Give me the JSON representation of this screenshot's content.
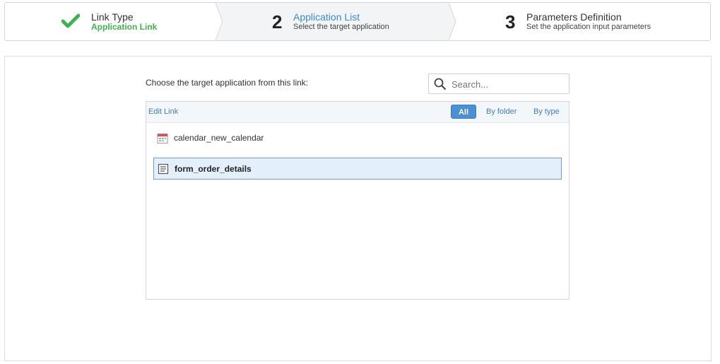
{
  "stepper": {
    "steps": [
      {
        "title": "Link Type",
        "subtitle": "Application Link",
        "status": "completed"
      },
      {
        "number": "2",
        "title": "Application List",
        "subtitle": "Select the target application",
        "status": "active"
      },
      {
        "number": "3",
        "title": "Parameters Definition",
        "subtitle": "Set the application input parameters",
        "status": "pending"
      }
    ]
  },
  "main": {
    "prompt": "Choose the target application from this link:",
    "search": {
      "placeholder": "Search...",
      "value": ""
    },
    "list": {
      "edit_link": "Edit Link",
      "filters": {
        "all": "All",
        "by_folder": "By folder",
        "by_type": "By type",
        "selected": "All"
      },
      "items": [
        {
          "label": "calendar_new_calendar",
          "icon": "calendar-icon",
          "selected": false
        },
        {
          "label": "form_order_details",
          "icon": "form-icon",
          "selected": true
        }
      ]
    }
  },
  "colors": {
    "accent": "#3b8ad0",
    "success": "#3fb34f",
    "selected_bg": "#e3f0fb"
  }
}
